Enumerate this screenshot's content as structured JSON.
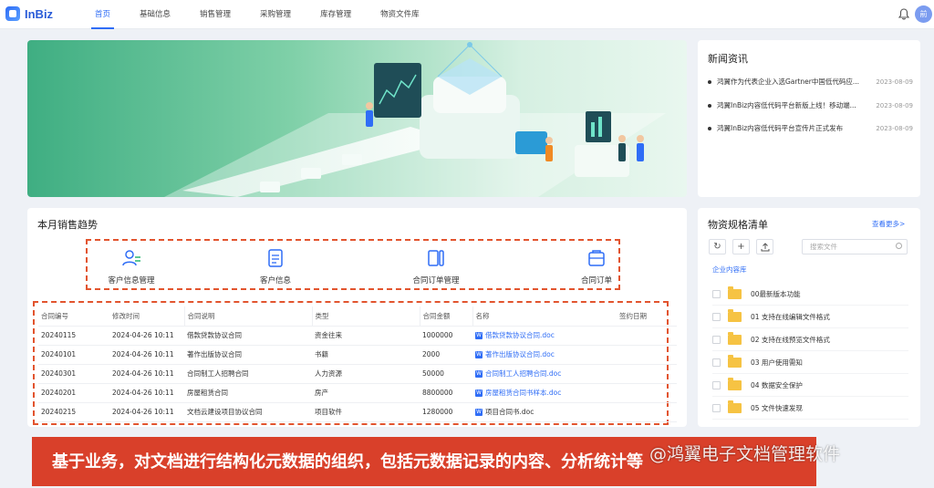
{
  "app": {
    "logo_text": "InBiz",
    "avatar_text": "前"
  },
  "nav": {
    "items": [
      "首页",
      "基础信息",
      "销售管理",
      "采购管理",
      "库存管理",
      "物资文件库"
    ],
    "active": 0
  },
  "news": {
    "title": "新闻资讯",
    "items": [
      {
        "text": "鸿翼作为代表企业入选Gartner中国低代码应...",
        "date": "2023-08-09"
      },
      {
        "text": "鸿翼InBiz内容低代码平台新版上线！移动端...",
        "date": "2023-08-09"
      },
      {
        "text": "鸿翼InBiz内容低代码平台宣传片正式发布",
        "date": "2023-08-09"
      }
    ]
  },
  "sales": {
    "title": "本月销售趋势",
    "quick_actions": [
      "客户信息管理",
      "客户信息",
      "合同订单管理",
      "合同订单"
    ],
    "columns": [
      "合同编号",
      "修改时间",
      "合同说明",
      "类型",
      "合同金额",
      "名称",
      "签约日期"
    ],
    "rows": [
      {
        "id": "20240115",
        "time": "2024-04-26 10:11",
        "desc": "借款贷款协议合同",
        "type": "资金往来",
        "amount": "1000000",
        "name": "借款贷款协议合同.doc",
        "link": true
      },
      {
        "id": "20240101",
        "time": "2024-04-26 10:11",
        "desc": "著作出版协议合同",
        "type": "书籍",
        "amount": "2000",
        "name": "著作出版协议合同.doc",
        "link": true
      },
      {
        "id": "20240301",
        "time": "2024-04-26 10:11",
        "desc": "合同制工人招聘合同",
        "type": "人力资源",
        "amount": "50000",
        "name": "合同制工人招聘合同.doc",
        "link": true
      },
      {
        "id": "20240201",
        "time": "2024-04-26 10:11",
        "desc": "房屋租赁合同",
        "type": "房产",
        "amount": "8800000",
        "name": "房屋租赁合同书样本.doc",
        "link": true
      },
      {
        "id": "20240215",
        "time": "2024-04-26 10:11",
        "desc": "文档云建设项目协议合同",
        "type": "项目软件",
        "amount": "1280000",
        "name": "项目合同书.doc",
        "link": false
      }
    ]
  },
  "materials": {
    "title": "物资规格清单",
    "more": "查看更多>",
    "search_placeholder": "搜索文件",
    "breadcrumb": "企业内容库",
    "folders": [
      "00最新版本功能",
      "01 支持在线编辑文件格式",
      "02 支持在线预览文件格式",
      "03 用户使用需知",
      "04 数据安全保护",
      "05 文件快速发现"
    ]
  },
  "caption": {
    "text": "基于业务，对文档进行结构化元数据的组织，包括元数据记录的内容、分析统计等",
    "watermark": "@鸿翼电子文档管理软件"
  },
  "colors": {
    "accent": "#2f6df6",
    "dashed_box": "#e2542e",
    "caption_bg": "#d9402a",
    "folder": "#f6c343"
  }
}
